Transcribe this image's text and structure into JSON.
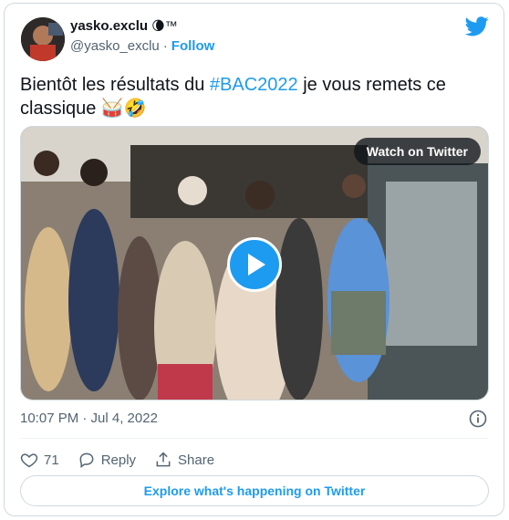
{
  "author": {
    "display_name": "yasko.exclu",
    "name_emoji": "🌘™",
    "handle": "@yasko_exclu",
    "separator": "·",
    "follow_label": "Follow"
  },
  "tweet": {
    "text_before": "Bientôt les résultats du ",
    "hashtag": "#BAC2022",
    "text_after": " je vous remets ce classique 🥁🤣"
  },
  "media": {
    "watch_label": "Watch on Twitter"
  },
  "meta": {
    "timestamp": "10:07 PM · Jul 4, 2022"
  },
  "actions": {
    "like_count": "71",
    "reply_label": "Reply",
    "share_label": "Share"
  },
  "explore_label": "Explore what's happening on Twitter",
  "colors": {
    "accent": "#1d9bf0",
    "text": "#0f1419",
    "muted": "#536471",
    "border": "#cfd9de"
  },
  "icons": [
    "twitter-bird-icon",
    "play-icon",
    "info-icon",
    "heart-icon",
    "reply-icon",
    "share-icon"
  ]
}
